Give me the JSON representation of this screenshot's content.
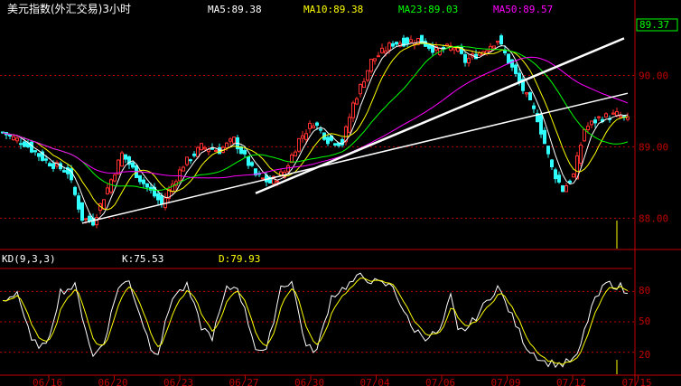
{
  "header": {
    "title": "美元指数(外汇交易)3小时",
    "ma5": "MA5:89.38",
    "ma10": "MA10:89.38",
    "ma23": "MA23:89.03",
    "ma50": "MA50:89.57"
  },
  "kd_header": {
    "name": "KD(9,3,3)",
    "k": "K:75.53",
    "d": "D:79.93"
  },
  "price_axis": {
    "current": "89.37",
    "ticks": [
      "90.00",
      "89.00",
      "88.00"
    ]
  },
  "kd_axis": {
    "ticks": [
      "80",
      "50",
      "20"
    ]
  },
  "date_ticks": [
    "06/16",
    "06/20",
    "06/23",
    "06/27",
    "06/30",
    "07/04",
    "07/06",
    "07/09",
    "07/12",
    "07/15"
  ],
  "colors": {
    "up": "#ff3030",
    "down": "#30ffff",
    "ma5": "#ffffff",
    "ma10": "#ffff00",
    "ma23": "#00ff00",
    "ma50": "#ff00ff",
    "grid": "#c00000",
    "title": "#ffffff"
  },
  "chart_data": {
    "type": "candlestick",
    "ylim": [
      87.6,
      90.55
    ],
    "kd_ylim": [
      0,
      100
    ],
    "anchor_points": [
      {
        "i": 0,
        "p": 89.2
      },
      {
        "i": 6,
        "p": 89.05
      },
      {
        "i": 12,
        "p": 88.8
      },
      {
        "i": 18,
        "p": 88.65
      },
      {
        "i": 22,
        "p": 88.0
      },
      {
        "i": 25,
        "p": 87.95
      },
      {
        "i": 28,
        "p": 88.3
      },
      {
        "i": 33,
        "p": 88.9
      },
      {
        "i": 38,
        "p": 88.55
      },
      {
        "i": 44,
        "p": 88.2
      },
      {
        "i": 50,
        "p": 88.75
      },
      {
        "i": 55,
        "p": 89.0
      },
      {
        "i": 60,
        "p": 88.95
      },
      {
        "i": 64,
        "p": 89.1
      },
      {
        "i": 70,
        "p": 88.6
      },
      {
        "i": 74,
        "p": 88.5
      },
      {
        "i": 78,
        "p": 88.65
      },
      {
        "i": 82,
        "p": 89.1
      },
      {
        "i": 86,
        "p": 89.35
      },
      {
        "i": 90,
        "p": 89.1
      },
      {
        "i": 94,
        "p": 89.05
      },
      {
        "i": 97,
        "p": 89.6
      },
      {
        "i": 102,
        "p": 90.2
      },
      {
        "i": 108,
        "p": 90.45
      },
      {
        "i": 115,
        "p": 90.5
      },
      {
        "i": 120,
        "p": 90.35
      },
      {
        "i": 125,
        "p": 90.4
      },
      {
        "i": 128,
        "p": 90.2
      },
      {
        "i": 133,
        "p": 90.35
      },
      {
        "i": 137,
        "p": 90.5
      },
      {
        "i": 140,
        "p": 90.2
      },
      {
        "i": 144,
        "p": 89.8
      },
      {
        "i": 148,
        "p": 89.4
      },
      {
        "i": 152,
        "p": 88.7
      },
      {
        "i": 155,
        "p": 88.4
      },
      {
        "i": 158,
        "p": 88.6
      },
      {
        "i": 161,
        "p": 89.25
      },
      {
        "i": 165,
        "p": 89.4
      },
      {
        "i": 170,
        "p": 89.45
      },
      {
        "i": 173,
        "p": 89.37
      }
    ],
    "kd_anchor_points": [
      {
        "i": 0,
        "k": 70
      },
      {
        "i": 4,
        "k": 80
      },
      {
        "i": 8,
        "k": 30
      },
      {
        "i": 12,
        "k": 25
      },
      {
        "i": 16,
        "k": 80
      },
      {
        "i": 20,
        "k": 85
      },
      {
        "i": 25,
        "k": 15
      },
      {
        "i": 28,
        "k": 30
      },
      {
        "i": 32,
        "k": 85
      },
      {
        "i": 35,
        "k": 90
      },
      {
        "i": 41,
        "k": 25
      },
      {
        "i": 43,
        "k": 20
      },
      {
        "i": 47,
        "k": 75
      },
      {
        "i": 51,
        "k": 85
      },
      {
        "i": 55,
        "k": 45
      },
      {
        "i": 58,
        "k": 35
      },
      {
        "i": 62,
        "k": 82
      },
      {
        "i": 65,
        "k": 85
      },
      {
        "i": 70,
        "k": 25
      },
      {
        "i": 73,
        "k": 20
      },
      {
        "i": 77,
        "k": 85
      },
      {
        "i": 80,
        "k": 90
      },
      {
        "i": 84,
        "k": 25
      },
      {
        "i": 87,
        "k": 22
      },
      {
        "i": 91,
        "k": 75
      },
      {
        "i": 95,
        "k": 85
      },
      {
        "i": 99,
        "k": 95
      },
      {
        "i": 104,
        "k": 88
      },
      {
        "i": 108,
        "k": 85
      },
      {
        "i": 113,
        "k": 45
      },
      {
        "i": 117,
        "k": 35
      },
      {
        "i": 121,
        "k": 40
      },
      {
        "i": 124,
        "k": 75
      },
      {
        "i": 126,
        "k": 40
      },
      {
        "i": 129,
        "k": 45
      },
      {
        "i": 134,
        "k": 70
      },
      {
        "i": 137,
        "k": 85
      },
      {
        "i": 141,
        "k": 55
      },
      {
        "i": 145,
        "k": 25
      },
      {
        "i": 150,
        "k": 10
      },
      {
        "i": 155,
        "k": 8
      },
      {
        "i": 159,
        "k": 15
      },
      {
        "i": 163,
        "k": 65
      },
      {
        "i": 167,
        "k": 88
      },
      {
        "i": 171,
        "k": 85
      },
      {
        "i": 173,
        "k": 76
      }
    ],
    "trendlines": [
      {
        "from": {
          "i": 22,
          "p": 87.93
        },
        "to": {
          "i": 173,
          "p": 89.75
        }
      },
      {
        "from": {
          "i": 70,
          "p": 88.35
        },
        "to": {
          "i": 172,
          "p": 90.52
        }
      }
    ],
    "volume_marker": {
      "i": 170
    }
  }
}
